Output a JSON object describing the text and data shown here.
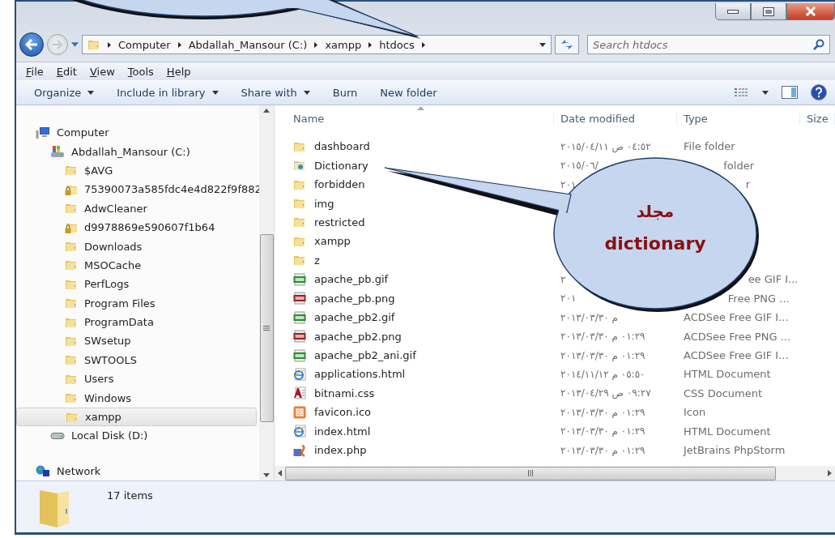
{
  "address": {
    "path": [
      "Computer",
      "Abdallah_Mansour (C:)",
      "xampp",
      "htdocs"
    ]
  },
  "search": {
    "placeholder": "Search htdocs"
  },
  "menu": [
    "File",
    "Edit",
    "View",
    "Tools",
    "Help"
  ],
  "toolbar": [
    {
      "label": "Organize",
      "menu": true
    },
    {
      "label": "Include in library",
      "menu": true
    },
    {
      "label": "Share with",
      "menu": true
    },
    {
      "label": "Burn",
      "menu": false
    },
    {
      "label": "New folder",
      "menu": false
    }
  ],
  "nav": {
    "tree": [
      {
        "label": "Computer",
        "kind": "computer",
        "selected": false,
        "children": [
          {
            "label": "Abdallah_Mansour (C:)",
            "kind": "system-drive",
            "selected": false,
            "children": [
              {
                "label": "$AVG",
                "kind": "folder",
                "selected": false
              },
              {
                "label": "75390073a585fdc4e4d822f9f882",
                "kind": "locked-folder",
                "selected": false
              },
              {
                "label": "AdwCleaner",
                "kind": "folder",
                "selected": false
              },
              {
                "label": "d9978869e590607f1b64",
                "kind": "locked-folder",
                "selected": false
              },
              {
                "label": "Downloads",
                "kind": "folder",
                "selected": false
              },
              {
                "label": "MSOCache",
                "kind": "folder",
                "selected": false
              },
              {
                "label": "PerfLogs",
                "kind": "folder",
                "selected": false
              },
              {
                "label": "Program Files",
                "kind": "folder",
                "selected": false
              },
              {
                "label": "ProgramData",
                "kind": "folder",
                "selected": false
              },
              {
                "label": "SWsetup",
                "kind": "folder",
                "selected": false
              },
              {
                "label": "SWTOOLS",
                "kind": "folder",
                "selected": false
              },
              {
                "label": "Users",
                "kind": "folder",
                "selected": false
              },
              {
                "label": "Windows",
                "kind": "folder",
                "selected": false
              },
              {
                "label": "xampp",
                "kind": "folder",
                "selected": true
              }
            ]
          },
          {
            "label": "Local Disk (D:)",
            "kind": "disk",
            "selected": false
          }
        ]
      },
      {
        "label": "Network",
        "kind": "network",
        "selected": false
      }
    ]
  },
  "files": {
    "columns": [
      "Name",
      "Date modified",
      "Type",
      "Size"
    ],
    "rows": [
      {
        "name": "dashboard",
        "kind": "folder",
        "date": "٢٠١٥/٠٤/١١ ص ٠٤:٥٢",
        "type": "File folder",
        "selected": false
      },
      {
        "name": "Dictionary",
        "kind": "web-folder",
        "date": "٢٠١٥/٠٦/",
        "type": "folder",
        "selected": false
      },
      {
        "name": "forbidden",
        "kind": "folder",
        "date": "٢٠١",
        "type": "r",
        "selected": false
      },
      {
        "name": "img",
        "kind": "folder",
        "selected": false
      },
      {
        "name": "restricted",
        "kind": "folder",
        "selected": false
      },
      {
        "name": "xampp",
        "kind": "folder",
        "selected": false
      },
      {
        "name": "z",
        "kind": "folder",
        "selected": false
      },
      {
        "name": "apache_pb.gif",
        "kind": "gif",
        "date": "٢",
        "type": "ee GIF I...",
        "selected": false
      },
      {
        "name": "apache_pb.png",
        "kind": "png",
        "date": "٢٠١",
        "type": "Free PNG ...",
        "selected": false
      },
      {
        "name": "apache_pb2.gif",
        "kind": "gif",
        "date": "٢٠١٣/٠٣/٣٠ م",
        "type": "ACDSee Free GIF I...",
        "selected": false
      },
      {
        "name": "apache_pb2.png",
        "kind": "png",
        "date": "٢٠١٣/٠٣/٣٠ م ٠١:٢٩",
        "type": "ACDSee Free PNG ...",
        "selected": false
      },
      {
        "name": "apache_pb2_ani.gif",
        "kind": "gif",
        "date": "٢٠١٣/٠٣/٣٠ م ٠١:٢٩",
        "type": "ACDSee Free GIF I...",
        "selected": false
      },
      {
        "name": "applications.html",
        "kind": "html",
        "date": "٢٠١٤/١١/١٢ م ٠٥:٥٠",
        "type": "HTML Document",
        "selected": false
      },
      {
        "name": "bitnami.css",
        "kind": "css",
        "date": "٢٠١٣/٠٤/٢٩ ص ٠٩:٢٧",
        "type": "CSS Document",
        "selected": false
      },
      {
        "name": "favicon.ico",
        "kind": "ico",
        "date": "٢٠١٣/٠٣/٣٠ م ٠١:٢٩",
        "type": "Icon",
        "selected": false
      },
      {
        "name": "index.html",
        "kind": "html",
        "date": "٢٠١٣/٠٣/٣٠ م ٠١:٢٩",
        "type": "HTML Document",
        "selected": false
      },
      {
        "name": "index.php",
        "kind": "php",
        "date": "٢٠١٣/٠٣/٣٠ م ٠١:٢٩",
        "type": "JetBrains PhpStorm",
        "selected": false
      }
    ]
  },
  "status_bar": {
    "text": "17 items"
  },
  "callout": {
    "lines": [
      "مجلد",
      "dictionary"
    ]
  }
}
